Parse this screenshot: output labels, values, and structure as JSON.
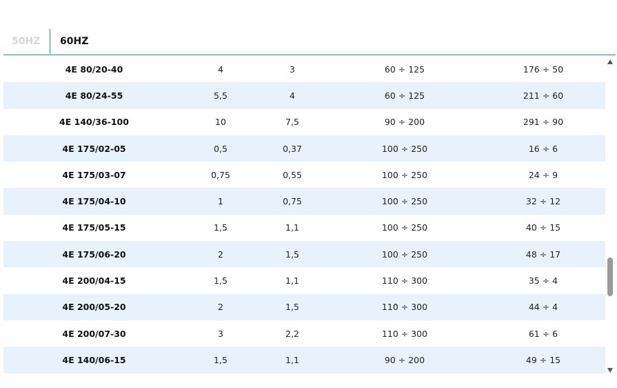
{
  "tabs": [
    {
      "label": "50HZ",
      "active": false
    },
    {
      "label": "60HZ",
      "active": true
    }
  ],
  "table": {
    "rows": [
      [
        "4E 80/20-40",
        "4",
        "3",
        "60 ÷ 125",
        "176 ÷ 50"
      ],
      [
        "4E 80/24-55",
        "5,5",
        "4",
        "60 ÷ 125",
        "211 ÷ 60"
      ],
      [
        "4E 140/36-100",
        "10",
        "7,5",
        "90 ÷ 200",
        "291 ÷ 90"
      ],
      [
        "4E 175/02-05",
        "0,5",
        "0,37",
        "100 ÷ 250",
        "16 ÷ 6"
      ],
      [
        "4E 175/03-07",
        "0,75",
        "0,55",
        "100 ÷ 250",
        "24 ÷ 9"
      ],
      [
        "4E 175/04-10",
        "1",
        "0,75",
        "100 ÷ 250",
        "32 ÷ 12"
      ],
      [
        "4E 175/05-15",
        "1,5",
        "1,1",
        "100 ÷ 250",
        "40 ÷ 15"
      ],
      [
        "4E 175/06-20",
        "2",
        "1,5",
        "100 ÷ 250",
        "48 ÷ 17"
      ],
      [
        "4E 200/04-15",
        "1,5",
        "1,1",
        "110 ÷ 300",
        "35 ÷ 4"
      ],
      [
        "4E 200/05-20",
        "2",
        "1,5",
        "110 ÷ 300",
        "44 ÷ 4"
      ],
      [
        "4E 200/07-30",
        "3",
        "2,2",
        "110 ÷ 300",
        "61 ÷ 6"
      ],
      [
        "4E 140/06-15",
        "1,5",
        "1,1",
        "90 ÷ 200",
        "49 ÷ 15"
      ]
    ]
  },
  "colors": {
    "accent": "#2a8aa7",
    "row_stripe": "#e8f2fc",
    "inactive_tab": "#d6d6d6"
  },
  "icons": {
    "scroll_up": "triangle-up-icon",
    "scroll_down": "triangle-down-icon"
  }
}
